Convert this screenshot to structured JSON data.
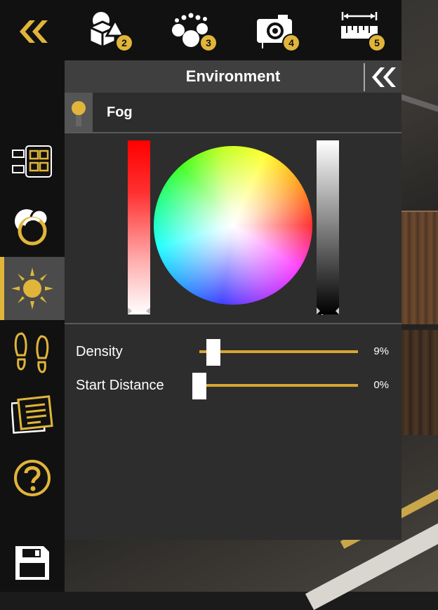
{
  "panel": {
    "title": "Environment",
    "section": "Fog",
    "fog_enabled": true
  },
  "toolbar": {
    "tools": [
      {
        "icon": "shapes-icon",
        "badge": "2"
      },
      {
        "icon": "nodes-icon",
        "badge": "3"
      },
      {
        "icon": "camera-icon",
        "badge": "4"
      },
      {
        "icon": "ruler-icon",
        "badge": "5"
      }
    ]
  },
  "sidebar": {
    "items": [
      {
        "icon": "collapse-chevrons-icon"
      },
      {
        "icon": "layout-grid-icon"
      },
      {
        "icon": "materials-icon"
      },
      {
        "icon": "sun-icon",
        "active": true
      },
      {
        "icon": "footsteps-icon"
      },
      {
        "icon": "notes-icon"
      },
      {
        "icon": "help-icon"
      },
      {
        "icon": "save-icon"
      }
    ]
  },
  "sliders": {
    "density": {
      "label": "Density",
      "value": "9%",
      "fraction": 0.09
    },
    "start_distance": {
      "label": "Start Distance",
      "value": "0%",
      "fraction": 0.0
    }
  },
  "colors": {
    "accent": "#e1b53a",
    "panel_bg": "#2d2d2d",
    "header_bg": "#3f3f3f"
  }
}
